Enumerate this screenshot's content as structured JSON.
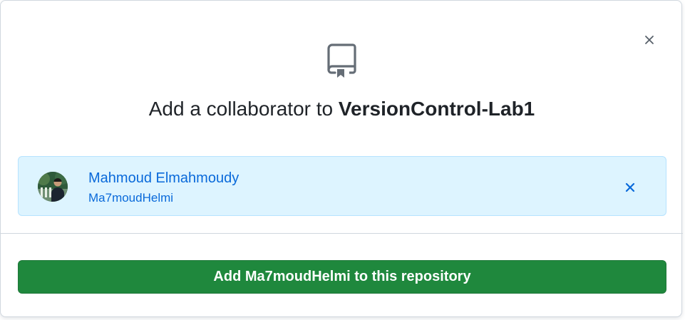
{
  "dialog": {
    "title_prefix": "Add a collaborator to",
    "repo_name": "VersionControl-Lab1",
    "close_icon": "x-icon",
    "repo_icon": "repo-icon"
  },
  "selected_user": {
    "name": "Mahmoud Elmahmoudy",
    "login": "Ma7moudHelmi",
    "remove_icon": "x-icon"
  },
  "actions": {
    "add_label": "Add Ma7moudHelmi to this repository"
  },
  "colors": {
    "primary_button": "#1f883d",
    "user_card_bg": "#ddf4ff",
    "link_blue": "#0969da",
    "text": "#1f2328"
  }
}
